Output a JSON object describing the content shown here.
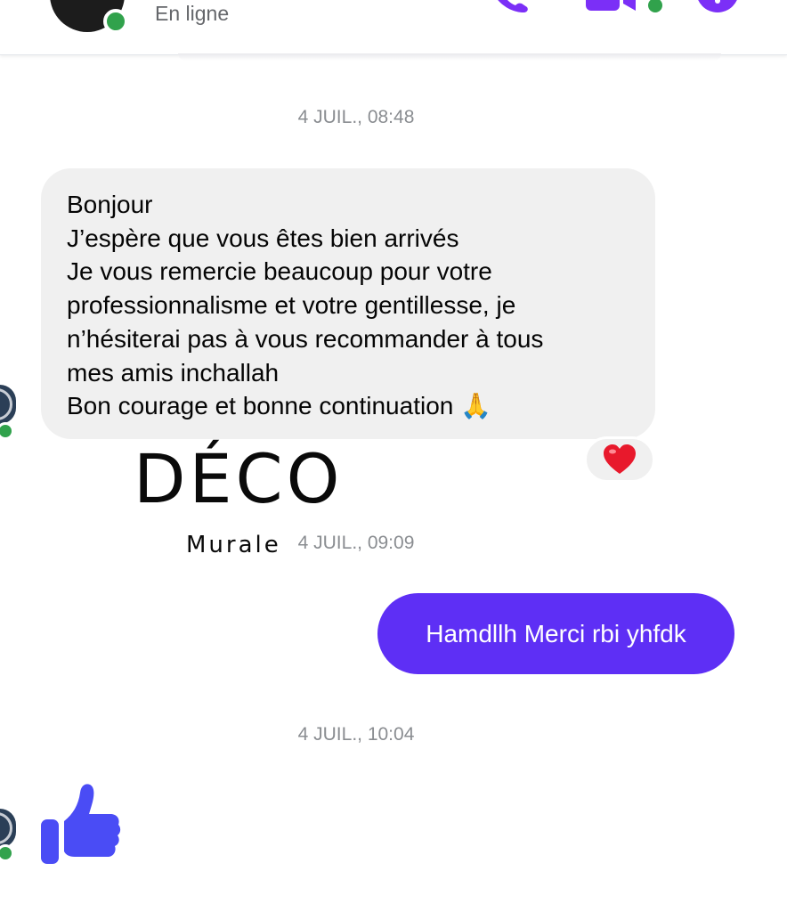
{
  "header": {
    "status": "En ligne",
    "colors": {
      "accent": "#7b2ff7",
      "presence": "#31a24c"
    },
    "icons": [
      "phone-icon",
      "video-call-icon",
      "info-icon"
    ]
  },
  "conversation": {
    "groups": [
      {
        "timestamp": "4 JUIL., 08:48",
        "incoming": {
          "lines": [
            "Bonjour",
            "J’espère que vous êtes bien arrivés",
            "Je vous remercie beaucoup pour votre",
            "professionnalisme et votre gentillesse, je",
            "n’hésiterai pas à vous recommander à tous",
            "mes amis inchallah",
            "Bon courage et bonne continuation 🙏"
          ],
          "reaction": "❤️"
        }
      },
      {
        "timestamp": "4 JUIL., 09:09",
        "outgoing": {
          "text": "Hamdllh Merci rbi yhfdk"
        }
      },
      {
        "timestamp": "4 JUIL., 10:04",
        "incoming": {
          "sticker": "thumbs-up-icon"
        }
      }
    ]
  },
  "watermark": {
    "title": "DÉCO",
    "subtitle": "Murale"
  },
  "colors": {
    "incoming_bubble": "#f0f0f0",
    "outgoing_bubble": "#5e2ff5",
    "like": "#4a4cf5",
    "timestamp": "#8a8d91"
  }
}
